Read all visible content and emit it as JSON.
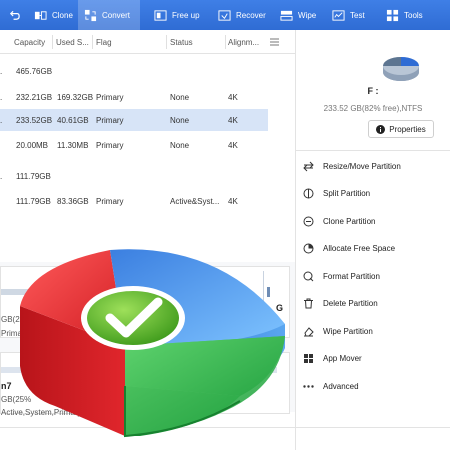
{
  "toolbar": {
    "items": [
      {
        "label": "Clone",
        "icon": "clone-icon"
      },
      {
        "label": "Convert",
        "icon": "convert-icon"
      },
      {
        "label": "Free up",
        "icon": "free-up-icon"
      },
      {
        "label": "Recover",
        "icon": "recover-icon"
      },
      {
        "label": "Wipe",
        "icon": "wipe-icon"
      },
      {
        "label": "Test",
        "icon": "test-icon"
      },
      {
        "label": "Tools",
        "icon": "tools-icon"
      }
    ],
    "active": "Convert",
    "color": "#3f7fe6"
  },
  "table": {
    "headers": [
      "Capacity",
      "Used S...",
      "Flag",
      "Status",
      "Alignm..."
    ],
    "rows": [
      {
        "lead": ".",
        "capacity": "465.76GB",
        "used": "",
        "flag": "",
        "status": "",
        "align": ""
      },
      {
        "lead": ".",
        "capacity": "232.21GB",
        "used": "169.32GB",
        "flag": "Primary",
        "status": "None",
        "align": "4K"
      },
      {
        "lead": ".",
        "capacity": "233.52GB",
        "used": "40.61GB",
        "flag": "Primary",
        "status": "None",
        "align": "4K",
        "selected": true
      },
      {
        "lead": "",
        "capacity": "20.00MB",
        "used": "11.30MB",
        "flag": "Primary",
        "status": "None",
        "align": "4K"
      },
      {
        "lead": ".",
        "capacity": "111.79GB",
        "used": "",
        "flag": "",
        "status": "",
        "align": ""
      },
      {
        "lead": "",
        "capacity": "111.79GB",
        "used": "83.36GB",
        "flag": "Primary",
        "status": "Active&Syst...",
        "align": "4K"
      }
    ]
  },
  "disk_map": {
    "card1": {
      "line1": "GB(27",
      "line2": "Prima",
      "right_char": "G",
      "right_line2": "2",
      "right_line3": "N"
    },
    "card2": {
      "title": "n7",
      "line1": "GB(25%",
      "line2": "Active,System,Primary"
    }
  },
  "panel": {
    "drive_label": "F :",
    "drive_info": "233.52 GB(82% free),NTFS",
    "properties_label": "Properties",
    "operations": [
      {
        "label": "Resize/Move Partition",
        "icon": "resize-icon"
      },
      {
        "label": "Split Partition",
        "icon": "split-icon"
      },
      {
        "label": "Clone Partition",
        "icon": "clone-partition-icon"
      },
      {
        "label": "Allocate Free Space",
        "icon": "allocate-icon"
      },
      {
        "label": "Format Partition",
        "icon": "format-icon"
      },
      {
        "label": "Delete Partition",
        "icon": "delete-icon"
      },
      {
        "label": "Wipe Partition",
        "icon": "wipe-partition-icon"
      },
      {
        "label": "App Mover",
        "icon": "app-mover-icon"
      },
      {
        "label": "Advanced",
        "icon": "more-icon"
      }
    ]
  },
  "colors": {
    "accent": "#3f7fe6",
    "selected_row": "#d7e4f7",
    "logo_red": "#d8262a",
    "logo_blue": "#2f7fd6",
    "logo_green": "#2aa84a"
  }
}
